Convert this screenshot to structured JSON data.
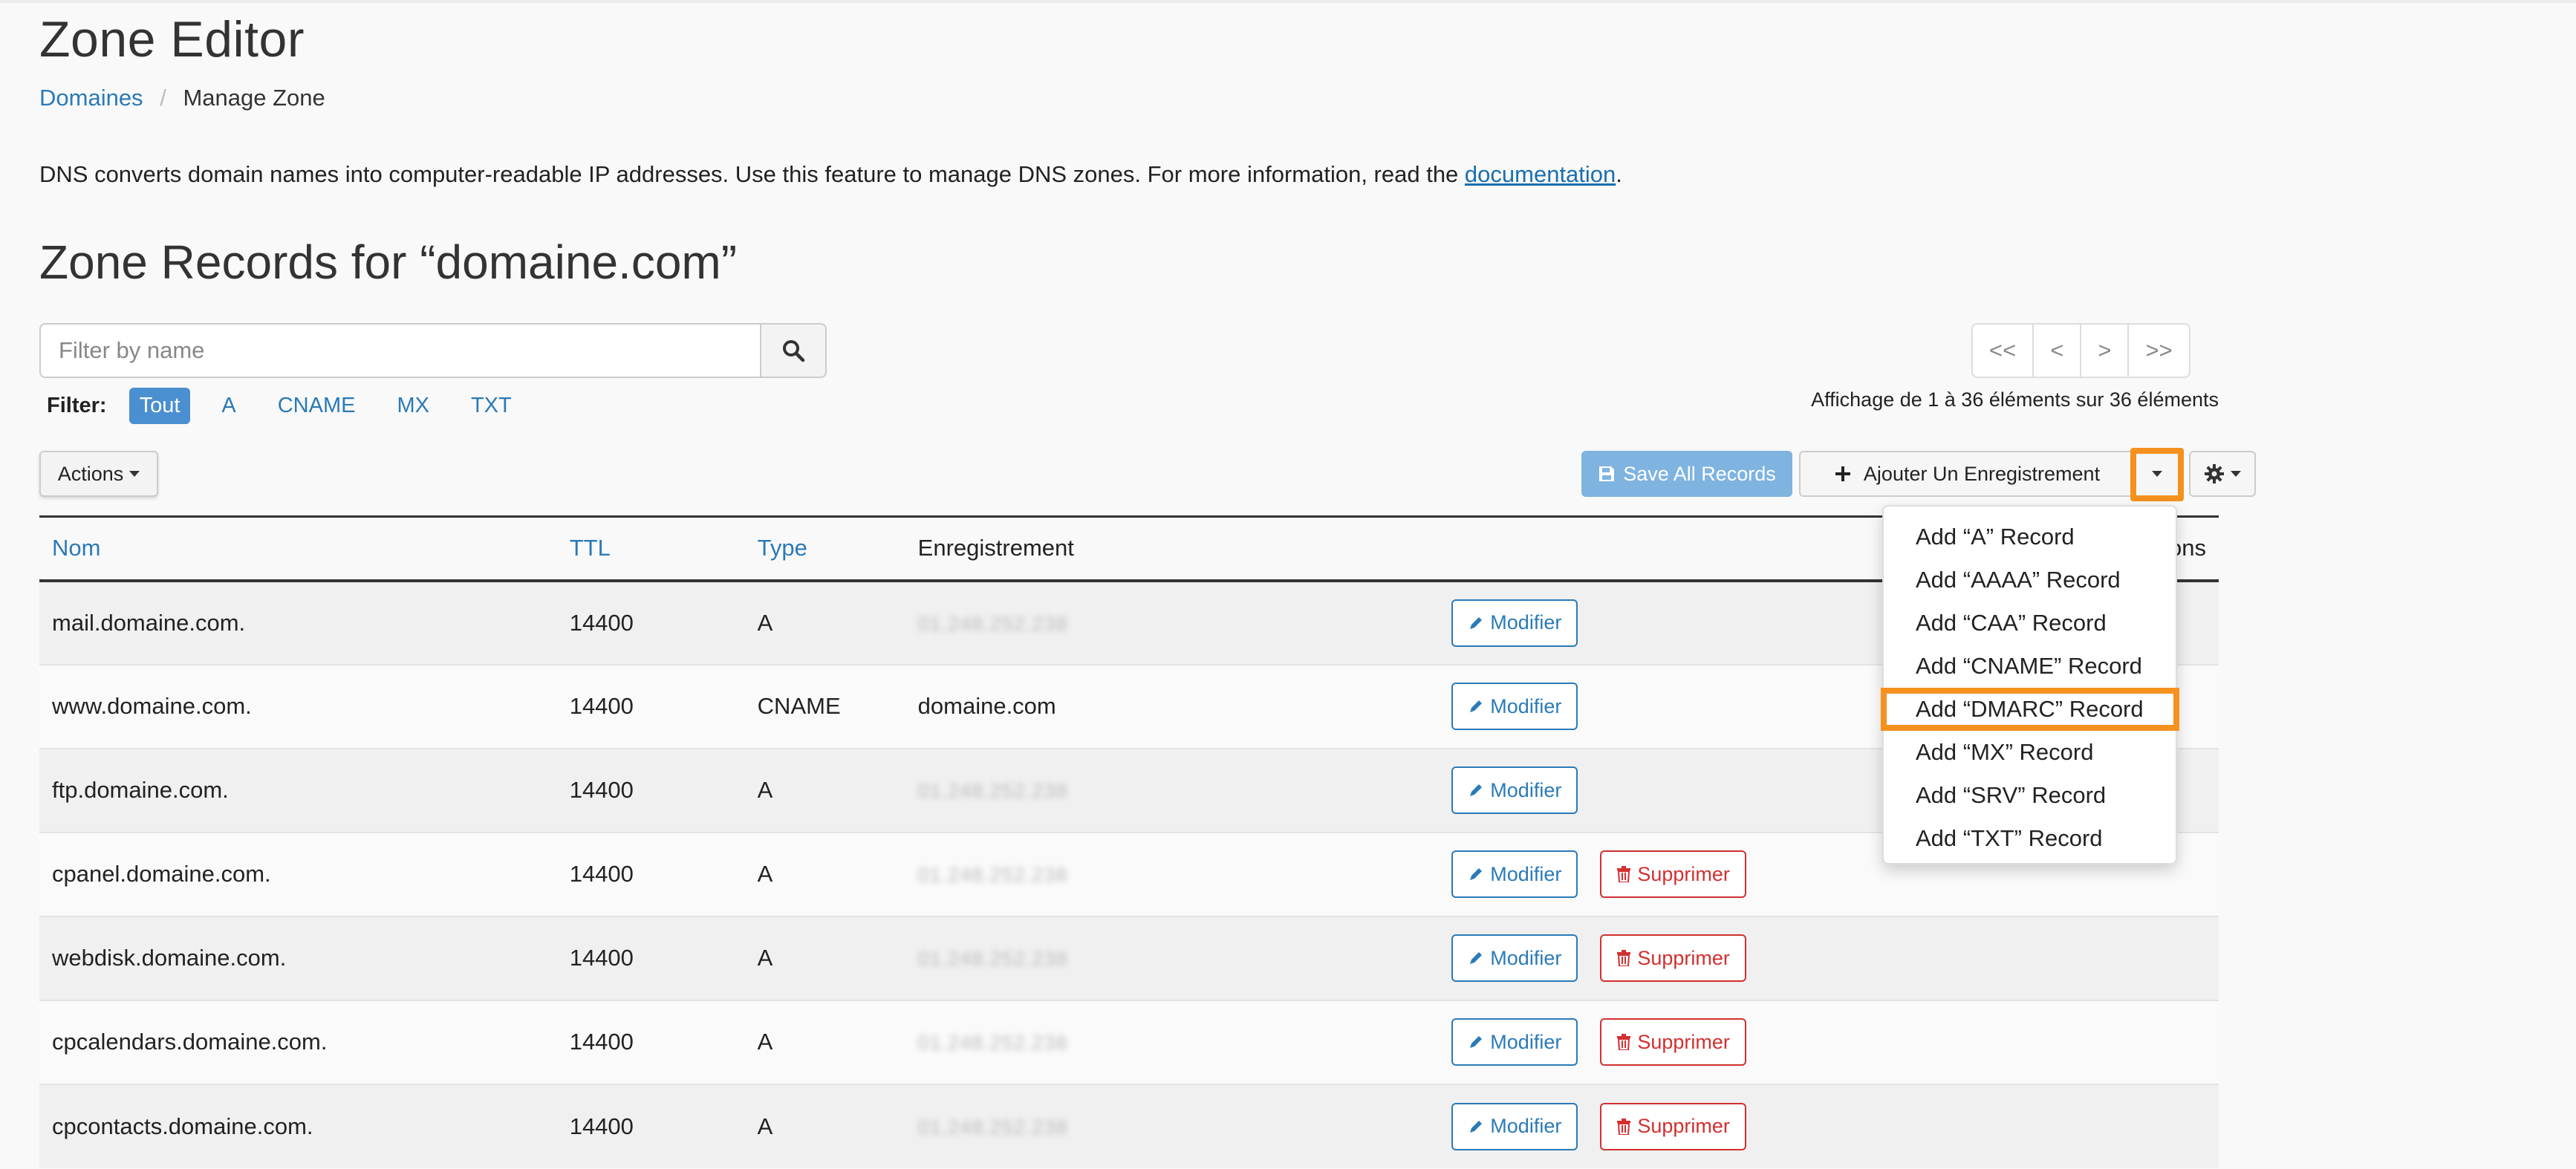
{
  "page": {
    "title": "Zone Editor",
    "breadcrumb": {
      "parent": "Domaines",
      "current": "Manage Zone"
    },
    "description_prefix": "DNS converts domain names into computer-readable IP addresses. Use this feature to manage DNS zones. For more information, read the ",
    "description_link": "documentation",
    "description_suffix": ".",
    "zone_heading": "Zone Records for “domaine.com”"
  },
  "search": {
    "placeholder": "Filter by name",
    "value": ""
  },
  "filter": {
    "label": "Filter:",
    "options": [
      "Tout",
      "A",
      "CNAME",
      "MX",
      "TXT"
    ],
    "active": "Tout"
  },
  "pagination": {
    "first": "<<",
    "prev": "<",
    "next": ">",
    "last": ">>",
    "summary": "Affichage de 1 à 36 éléments sur 36 éléments"
  },
  "toolbar": {
    "actions_label": "Actions",
    "save_label": "Save All Records",
    "add_label": "Ajouter Un Enregistrement"
  },
  "table": {
    "headers": {
      "name": "Nom",
      "ttl": "TTL",
      "type": "Type",
      "record": "Enregistrement",
      "actions": "Actions"
    },
    "edit_label": "Modifier",
    "delete_label": "Supprimer",
    "rows": [
      {
        "name": "mail.domaine.com.",
        "ttl": "14400",
        "type": "A",
        "record": "01.248.252.238"
      },
      {
        "name": "www.domaine.com.",
        "ttl": "14400",
        "type": "CNAME",
        "record": "domaine.com"
      },
      {
        "name": "ftp.domaine.com.",
        "ttl": "14400",
        "type": "A",
        "record": "01.248.252.238"
      },
      {
        "name": "cpanel.domaine.com.",
        "ttl": "14400",
        "type": "A",
        "record": "01.248.252.238"
      },
      {
        "name": "webdisk.domaine.com.",
        "ttl": "14400",
        "type": "A",
        "record": "01.248.252.238"
      },
      {
        "name": "cpcalendars.domaine.com.",
        "ttl": "14400",
        "type": "A",
        "record": "01.248.252.238"
      },
      {
        "name": "cpcontacts.domaine.com.",
        "ttl": "14400",
        "type": "A",
        "record": "01.248.252.238"
      }
    ]
  },
  "add_menu": {
    "items": [
      "Add “A” Record",
      "Add “AAAA” Record",
      "Add “CAA” Record",
      "Add “CNAME” Record",
      "Add “DMARC” Record",
      "Add “MX” Record",
      "Add “SRV” Record",
      "Add “TXT” Record"
    ],
    "highlighted": "Add “DMARC” Record"
  },
  "colors": {
    "link": "#2a7ab8",
    "highlight": "#f5911e",
    "danger": "#d32f2f",
    "primary_light": "#7fb3e0"
  }
}
